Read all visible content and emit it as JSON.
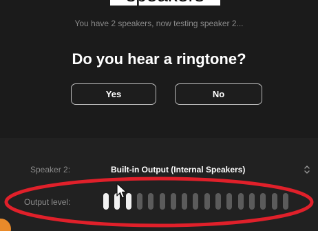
{
  "header": {
    "cropped_text": "speakers"
  },
  "dialog": {
    "subtitle": "You have 2 speakers, now testing speaker 2...",
    "question": "Do you hear a ringtone?",
    "yes_label": "Yes",
    "no_label": "No"
  },
  "speaker": {
    "label": "Speaker 2:",
    "selected": "Built-in Output (Internal Speakers)"
  },
  "output": {
    "label": "Output level:",
    "level": 0.17,
    "lit_bars": 3,
    "total_bars": 17
  },
  "colors": {
    "background": "#1c1c1c",
    "highlight_ring": "#e0202a",
    "accent_orange": "#e88a2a",
    "meter_lit": "#f2f2f2",
    "meter_off": "#5b5b5b"
  },
  "icons": {
    "select_chevron": "up-down-chevron-icon",
    "cursor": "mouse-pointer-icon"
  }
}
